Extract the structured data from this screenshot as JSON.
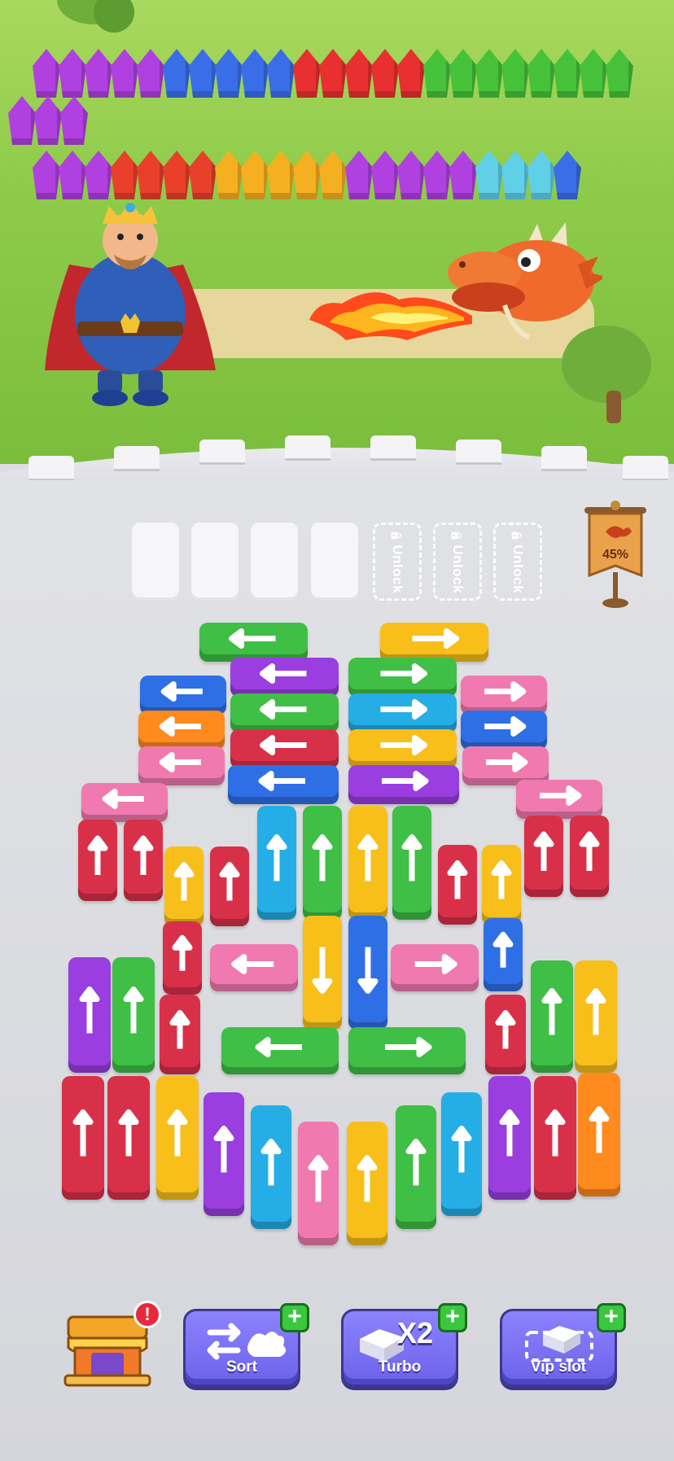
{
  "slots": {
    "empty_count": 4,
    "locked": [
      {
        "label": "Unlock"
      },
      {
        "label": "Unlock"
      },
      {
        "label": "Unlock"
      }
    ]
  },
  "progress": {
    "label": "45%",
    "value": 0.45
  },
  "toolbar": {
    "sort_label": "Sort",
    "turbo_label": "Turbo",
    "turbo_multiplier": "X2",
    "vip_label": "Vip slot",
    "plus": "+",
    "shop_alert": "!"
  },
  "icons": {
    "shop": "shop-stall-icon",
    "sort": "swap-arrows-icon",
    "turbo": "turbo-block-icon",
    "vip": "vip-slot-icon",
    "lock": "lock-icon",
    "banner": "dragon-banner-icon"
  },
  "colors": {
    "red": "#d9304a",
    "blue": "#2f6fe6",
    "green": "#3fbf45",
    "yellow": "#f8bf1a",
    "purple": "#9a3ee0",
    "pink": "#f07ab0",
    "orange": "#ff8a1e",
    "cyan": "#25aee5",
    "button": "#7a70f4"
  },
  "blocks": [
    {
      "c": "green",
      "d": "left"
    },
    {
      "c": "yellow",
      "d": "right"
    },
    {
      "c": "purple",
      "d": "left"
    },
    {
      "c": "green",
      "d": "right"
    },
    {
      "c": "blue",
      "d": "left"
    },
    {
      "c": "green",
      "d": "left"
    },
    {
      "c": "cyan",
      "d": "right"
    },
    {
      "c": "pink",
      "d": "right"
    },
    {
      "c": "orange",
      "d": "left"
    },
    {
      "c": "red",
      "d": "left"
    },
    {
      "c": "yellow",
      "d": "right"
    },
    {
      "c": "blue",
      "d": "right"
    },
    {
      "c": "pink",
      "d": "left"
    },
    {
      "c": "blue",
      "d": "left"
    },
    {
      "c": "purple",
      "d": "right"
    },
    {
      "c": "pink",
      "d": "right"
    },
    {
      "c": "pink",
      "d": "left"
    },
    {
      "c": "pink",
      "d": "right"
    },
    {
      "c": "red",
      "d": "up"
    },
    {
      "c": "red",
      "d": "up"
    },
    {
      "c": "cyan",
      "d": "up"
    },
    {
      "c": "green",
      "d": "up"
    },
    {
      "c": "yellow",
      "d": "up"
    },
    {
      "c": "green",
      "d": "up"
    },
    {
      "c": "red",
      "d": "up"
    },
    {
      "c": "red",
      "d": "up"
    },
    {
      "c": "yellow",
      "d": "up"
    },
    {
      "c": "red",
      "d": "up"
    },
    {
      "c": "red",
      "d": "up"
    },
    {
      "c": "yellow",
      "d": "up"
    },
    {
      "c": "red",
      "d": "up"
    },
    {
      "c": "pink",
      "d": "left"
    },
    {
      "c": "yellow",
      "d": "down"
    },
    {
      "c": "blue",
      "d": "down"
    },
    {
      "c": "pink",
      "d": "right"
    },
    {
      "c": "blue",
      "d": "up"
    },
    {
      "c": "purple",
      "d": "up"
    },
    {
      "c": "green",
      "d": "up"
    },
    {
      "c": "red",
      "d": "up"
    },
    {
      "c": "red",
      "d": "up"
    },
    {
      "c": "green",
      "d": "up"
    },
    {
      "c": "yellow",
      "d": "up"
    },
    {
      "c": "green",
      "d": "left"
    },
    {
      "c": "green",
      "d": "right"
    },
    {
      "c": "red",
      "d": "up"
    },
    {
      "c": "red",
      "d": "up"
    },
    {
      "c": "yellow",
      "d": "up"
    },
    {
      "c": "purple",
      "d": "up"
    },
    {
      "c": "cyan",
      "d": "up"
    },
    {
      "c": "pink",
      "d": "up"
    },
    {
      "c": "yellow",
      "d": "up"
    },
    {
      "c": "green",
      "d": "up"
    },
    {
      "c": "cyan",
      "d": "up"
    },
    {
      "c": "purple",
      "d": "up"
    },
    {
      "c": "red",
      "d": "up"
    },
    {
      "c": "orange",
      "d": "up"
    }
  ]
}
